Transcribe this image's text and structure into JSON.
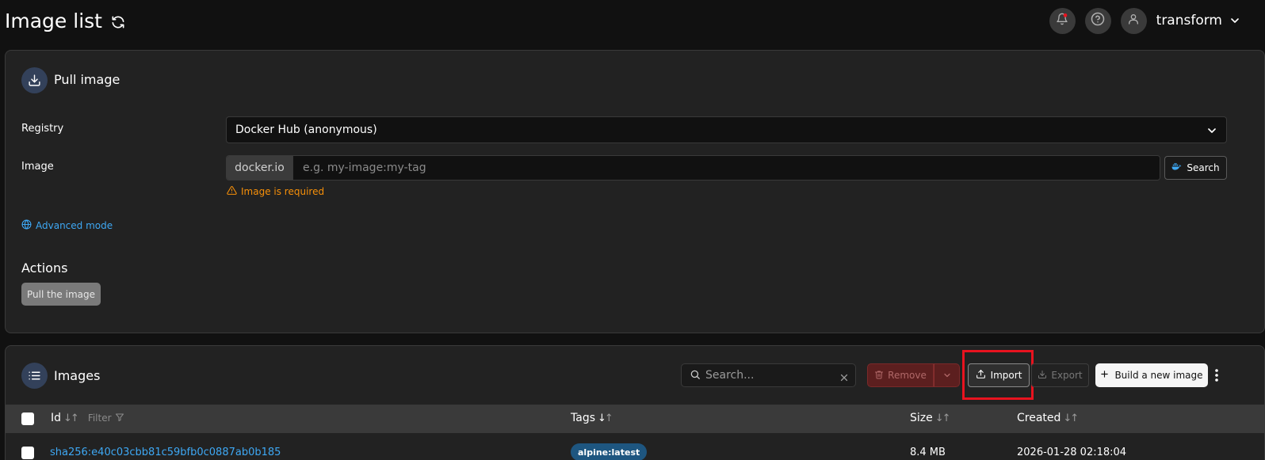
{
  "header": {
    "title": "Image list",
    "user_name": "transform"
  },
  "pull_panel": {
    "title": "Pull image",
    "registry_label": "Registry",
    "registry_value": "Docker Hub (anonymous)",
    "image_label": "Image",
    "image_prefix": "docker.io",
    "image_placeholder": "e.g. my-image:my-tag",
    "image_value": "",
    "search_label": "Search",
    "error": "Image is required",
    "advanced_link": "Advanced mode",
    "actions_title": "Actions",
    "pull_button": "Pull the image"
  },
  "images_panel": {
    "title": "Images",
    "search_placeholder": "Search...",
    "search_value": "",
    "remove_label": "Remove",
    "import_label": "Import",
    "export_label": "Export",
    "build_label": "Build a new image",
    "columns": {
      "id": "Id",
      "filter": "Filter",
      "tags": "Tags",
      "size": "Size",
      "created": "Created"
    },
    "rows": [
      {
        "id": "sha256:e40c03cbb81c59bfb0c0887ab0b185",
        "tag": "alpine:latest",
        "size": "8.4 MB",
        "created": "2026-01-28 02:18:04"
      }
    ]
  },
  "colors": {
    "background": "#111111",
    "panel": "#222222",
    "link": "#3ea8f4",
    "warning": "#f79009",
    "danger": "#5c1f1f",
    "highlight": "#e8131f",
    "notification_dot": "#e8131f"
  },
  "icons": {
    "refresh": "refresh-icon",
    "bell": "bell-icon",
    "help": "help-icon",
    "user": "user-icon",
    "download": "download-icon",
    "docker": "docker-icon",
    "warning": "warning-icon",
    "globe": "globe-icon",
    "list": "list-icon",
    "search": "search-icon",
    "trash": "trash-icon",
    "upload": "upload-icon",
    "plus": "plus-icon"
  }
}
